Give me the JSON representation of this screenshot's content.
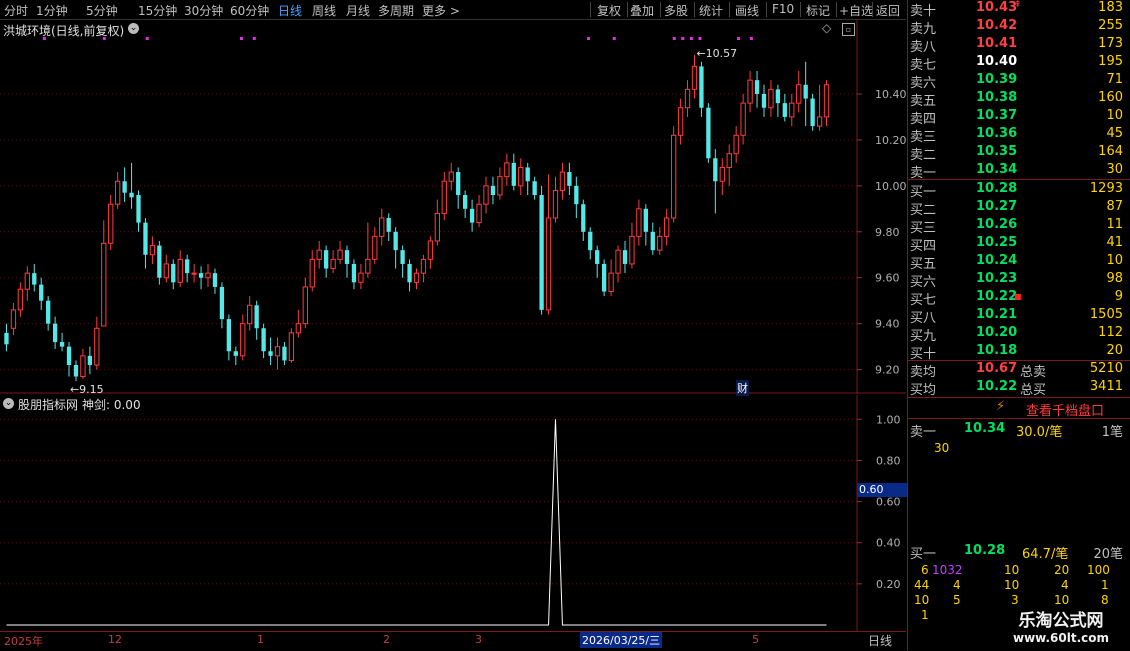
{
  "toolbar": {
    "periods": [
      "分时",
      "1分钟",
      "5分钟",
      "15分钟",
      "30分钟",
      "60分钟",
      "日线",
      "周线",
      "月线",
      "多周期",
      "更多 >"
    ],
    "selected_period": "日线",
    "right_buttons": [
      "复权",
      "叠加",
      "多股",
      "统计",
      "画线",
      "F10",
      "标记",
      "+自选",
      "返回"
    ]
  },
  "main_chart": {
    "title": "洪城环境(日线,前复权)",
    "price_labels": [
      "10.40",
      "10.20",
      "10.00",
      "9.80",
      "9.60",
      "9.40",
      "9.20"
    ],
    "high_marker": "10.57",
    "low_marker": "9.15",
    "cai_marker": "财",
    "colors": {
      "up": "#ff3b3b",
      "down": "#54e8e8"
    }
  },
  "sub_chart": {
    "title": "股朋指标网",
    "indicator": "神剑: 0.00",
    "y_labels": [
      "1.00",
      "0.80",
      "0.60",
      "0.40",
      "0.20"
    ],
    "cursor_value": "0.60"
  },
  "date_axis": {
    "labels": [
      "2025年",
      "12",
      "1",
      "2",
      "3",
      "5"
    ],
    "cursor_date": "2026/03/25/三",
    "period_label": "日线"
  },
  "chart_data": {
    "type": "candlestick",
    "ylim": [
      9.12,
      10.6
    ],
    "candles": [
      [
        9.36,
        9.31,
        9.4,
        9.28
      ],
      [
        9.38,
        9.46,
        9.49,
        9.35
      ],
      [
        9.46,
        9.55,
        9.58,
        9.43
      ],
      [
        9.55,
        9.62,
        9.65,
        9.5
      ],
      [
        9.62,
        9.57,
        9.66,
        9.54
      ],
      [
        9.57,
        9.5,
        9.6,
        9.46
      ],
      [
        9.5,
        9.4,
        9.52,
        9.37
      ],
      [
        9.4,
        9.32,
        9.43,
        9.29
      ],
      [
        9.32,
        9.3,
        9.36,
        9.28
      ],
      [
        9.3,
        9.22,
        9.32,
        9.17
      ],
      [
        9.22,
        9.17,
        9.24,
        9.15
      ],
      [
        9.17,
        9.26,
        9.29,
        9.16
      ],
      [
        9.26,
        9.22,
        9.3,
        9.18
      ],
      [
        9.22,
        9.38,
        9.43,
        9.2
      ],
      [
        9.39,
        9.75,
        9.85,
        9.72
      ],
      [
        9.75,
        9.92,
        9.96,
        9.72
      ],
      [
        9.92,
        10.02,
        10.06,
        9.9
      ],
      [
        10.02,
        9.97,
        10.08,
        9.93
      ],
      [
        9.97,
        9.95,
        10.1,
        9.9
      ],
      [
        9.96,
        9.84,
        9.98,
        9.8
      ],
      [
        9.84,
        9.7,
        9.86,
        9.64
      ],
      [
        9.7,
        9.74,
        9.78,
        9.66
      ],
      [
        9.74,
        9.6,
        9.76,
        9.57
      ],
      [
        9.6,
        9.66,
        9.7,
        9.58
      ],
      [
        9.66,
        9.58,
        9.68,
        9.55
      ],
      [
        9.58,
        9.68,
        9.72,
        9.56
      ],
      [
        9.68,
        9.62,
        9.7,
        9.58
      ],
      [
        9.62,
        9.62,
        9.66,
        9.58
      ],
      [
        9.62,
        9.6,
        9.65,
        9.55
      ],
      [
        9.6,
        9.62,
        9.66,
        9.56
      ],
      [
        9.62,
        9.56,
        9.64,
        9.53
      ],
      [
        9.56,
        9.42,
        9.58,
        9.38
      ],
      [
        9.42,
        9.28,
        9.44,
        9.24
      ],
      [
        9.28,
        9.26,
        9.3,
        9.22
      ],
      [
        9.26,
        9.4,
        9.44,
        9.24
      ],
      [
        9.4,
        9.48,
        9.52,
        9.37
      ],
      [
        9.48,
        9.38,
        9.5,
        9.33
      ],
      [
        9.38,
        9.28,
        9.4,
        9.25
      ],
      [
        9.28,
        9.26,
        9.34,
        9.22
      ],
      [
        9.26,
        9.3,
        9.34,
        9.2
      ],
      [
        9.3,
        9.24,
        9.32,
        9.22
      ],
      [
        9.24,
        9.36,
        9.38,
        9.23
      ],
      [
        9.36,
        9.4,
        9.46,
        9.34
      ],
      [
        9.4,
        9.56,
        9.6,
        9.38
      ],
      [
        9.56,
        9.68,
        9.72,
        9.54
      ],
      [
        9.68,
        9.72,
        9.76,
        9.64
      ],
      [
        9.72,
        9.64,
        9.74,
        9.6
      ],
      [
        9.64,
        9.68,
        9.72,
        9.62
      ],
      [
        9.68,
        9.72,
        9.76,
        9.66
      ],
      [
        9.72,
        9.66,
        9.74,
        9.6
      ],
      [
        9.66,
        9.58,
        9.68,
        9.55
      ],
      [
        9.58,
        9.62,
        9.66,
        9.55
      ],
      [
        9.62,
        9.68,
        9.84,
        9.6
      ],
      [
        9.68,
        9.78,
        9.82,
        9.66
      ],
      [
        9.78,
        9.86,
        9.9,
        9.74
      ],
      [
        9.86,
        9.8,
        9.88,
        9.76
      ],
      [
        9.8,
        9.72,
        9.82,
        9.64
      ],
      [
        9.72,
        9.66,
        9.74,
        9.6
      ],
      [
        9.66,
        9.58,
        9.68,
        9.54
      ],
      [
        9.58,
        9.62,
        9.64,
        9.55
      ],
      [
        9.62,
        9.68,
        9.7,
        9.58
      ],
      [
        9.68,
        9.76,
        9.78,
        9.64
      ],
      [
        9.76,
        9.88,
        9.94,
        9.74
      ],
      [
        9.88,
        10.02,
        10.06,
        9.85
      ],
      [
        10.02,
        10.06,
        10.1,
        9.98
      ],
      [
        10.06,
        9.96,
        10.08,
        9.9
      ],
      [
        9.96,
        9.9,
        9.98,
        9.86
      ],
      [
        9.9,
        9.84,
        9.94,
        9.8
      ],
      [
        9.84,
        9.92,
        9.96,
        9.82
      ],
      [
        9.92,
        10.0,
        10.04,
        9.88
      ],
      [
        10.0,
        9.96,
        10.04,
        9.92
      ],
      [
        9.96,
        10.04,
        10.08,
        9.94
      ],
      [
        10.04,
        10.1,
        10.14,
        10.0
      ],
      [
        10.1,
        10.0,
        10.14,
        9.98
      ],
      [
        10.0,
        10.08,
        10.12,
        9.96
      ],
      [
        10.08,
        10.02,
        10.1,
        9.96
      ],
      [
        10.02,
        9.96,
        10.04,
        9.94
      ],
      [
        9.96,
        9.46,
        10.0,
        9.44
      ],
      [
        9.46,
        9.86,
        10.05,
        9.44
      ],
      [
        9.86,
        9.98,
        10.04,
        9.84
      ],
      [
        9.98,
        10.06,
        10.1,
        9.94
      ],
      [
        10.06,
        10.0,
        10.1,
        9.96
      ],
      [
        10.0,
        9.92,
        10.04,
        9.86
      ],
      [
        9.92,
        9.8,
        9.94,
        9.76
      ],
      [
        9.8,
        9.72,
        9.82,
        9.68
      ],
      [
        9.72,
        9.66,
        9.74,
        9.6
      ],
      [
        9.66,
        9.54,
        9.68,
        9.52
      ],
      [
        9.54,
        9.62,
        9.68,
        9.52
      ],
      [
        9.62,
        9.72,
        9.74,
        9.58
      ],
      [
        9.72,
        9.66,
        9.76,
        9.62
      ],
      [
        9.66,
        9.78,
        9.84,
        9.64
      ],
      [
        9.78,
        9.9,
        9.94,
        9.74
      ],
      [
        9.9,
        9.8,
        9.92,
        9.74
      ],
      [
        9.8,
        9.72,
        9.84,
        9.7
      ],
      [
        9.72,
        9.78,
        9.82,
        9.7
      ],
      [
        9.78,
        9.86,
        9.9,
        9.74
      ],
      [
        9.86,
        10.22,
        10.26,
        9.84
      ],
      [
        10.22,
        10.34,
        10.38,
        10.18
      ],
      [
        10.34,
        10.42,
        10.46,
        10.3
      ],
      [
        10.42,
        10.52,
        10.57,
        10.38
      ],
      [
        10.52,
        10.34,
        10.54,
        10.3
      ],
      [
        10.34,
        10.12,
        10.36,
        10.1
      ],
      [
        10.12,
        10.02,
        10.16,
        9.88
      ],
      [
        10.02,
        10.08,
        10.12,
        9.96
      ],
      [
        10.08,
        10.14,
        10.18,
        10.0
      ],
      [
        10.14,
        10.22,
        10.26,
        10.1
      ],
      [
        10.22,
        10.36,
        10.4,
        10.18
      ],
      [
        10.36,
        10.46,
        10.5,
        10.32
      ],
      [
        10.46,
        10.4,
        10.5,
        10.34
      ],
      [
        10.4,
        10.34,
        10.44,
        10.3
      ],
      [
        10.34,
        10.42,
        10.46,
        10.3
      ],
      [
        10.42,
        10.36,
        10.44,
        10.3
      ],
      [
        10.36,
        10.3,
        10.4,
        10.28
      ],
      [
        10.3,
        10.36,
        10.4,
        10.26
      ],
      [
        10.36,
        10.44,
        10.5,
        10.32
      ],
      [
        10.44,
        10.38,
        10.54,
        10.26
      ],
      [
        10.38,
        10.26,
        10.4,
        10.24
      ],
      [
        10.26,
        10.3,
        10.44,
        10.24
      ],
      [
        10.3,
        10.44,
        10.46,
        10.26
      ]
    ],
    "indicator": {
      "name": "神剑",
      "values_spike_index": 79,
      "spike_value": 1.0,
      "ylim": [
        0,
        1.05
      ]
    }
  },
  "quote_panel": {
    "asks": [
      {
        "label": "卖十",
        "price": "10.43",
        "vol": "183",
        "dir": "up",
        "mark": "up-arrow"
      },
      {
        "label": "卖九",
        "price": "10.42",
        "vol": "255",
        "dir": "up"
      },
      {
        "label": "卖八",
        "price": "10.41",
        "vol": "173",
        "dir": "up"
      },
      {
        "label": "卖七",
        "price": "10.40",
        "vol": "195",
        "dir": "eq"
      },
      {
        "label": "卖六",
        "price": "10.39",
        "vol": "71",
        "dir": "dn"
      },
      {
        "label": "卖五",
        "price": "10.38",
        "vol": "160",
        "dir": "dn"
      },
      {
        "label": "卖四",
        "price": "10.37",
        "vol": "10",
        "dir": "dn"
      },
      {
        "label": "卖三",
        "price": "10.36",
        "vol": "45",
        "dir": "dn"
      },
      {
        "label": "卖二",
        "price": "10.35",
        "vol": "164",
        "dir": "dn"
      },
      {
        "label": "卖一",
        "price": "10.34",
        "vol": "30",
        "dir": "dn"
      }
    ],
    "bids": [
      {
        "label": "买一",
        "price": "10.28",
        "vol": "1293",
        "dir": "dn"
      },
      {
        "label": "买二",
        "price": "10.27",
        "vol": "87",
        "dir": "dn"
      },
      {
        "label": "买三",
        "price": "10.26",
        "vol": "11",
        "dir": "dn"
      },
      {
        "label": "买四",
        "price": "10.25",
        "vol": "41",
        "dir": "dn"
      },
      {
        "label": "买五",
        "price": "10.24",
        "vol": "10",
        "dir": "dn"
      },
      {
        "label": "买六",
        "price": "10.23",
        "vol": "98",
        "dir": "dn"
      },
      {
        "label": "买七",
        "price": "10.22",
        "vol": "9",
        "dir": "dn",
        "mark": "red-dot"
      },
      {
        "label": "买八",
        "price": "10.21",
        "vol": "1505",
        "dir": "dn"
      },
      {
        "label": "买九",
        "price": "10.20",
        "vol": "112",
        "dir": "dn"
      },
      {
        "label": "买十",
        "price": "10.18",
        "vol": "20",
        "dir": "dn"
      }
    ],
    "avg_sell_label": "卖均",
    "avg_sell_price": "10.67",
    "total_sell_label": "总卖",
    "total_sell": "5210",
    "avg_buy_label": "买均",
    "avg_buy_price": "10.22",
    "total_buy_label": "总买",
    "total_buy": "3411",
    "qianpan_button": "查看千档盘口",
    "sell1": {
      "label": "卖一",
      "price": "10.34",
      "per": "30.0/笔",
      "count": "1笔",
      "orders": [
        "30"
      ]
    },
    "buy1": {
      "label": "买一",
      "price": "10.28",
      "per": "64.7/笔",
      "count": "20笔",
      "orders": [
        [
          "6",
          "1032",
          "10",
          "20",
          "100"
        ],
        [
          "44",
          "4",
          "10",
          "4",
          "1"
        ],
        [
          "10",
          "5",
          "3",
          "10",
          "8"
        ],
        [
          "1",
          "",
          "",
          "",
          ""
        ]
      ]
    }
  },
  "watermark": {
    "line1": "乐淘公式网",
    "line2": "www.60lt.com"
  }
}
